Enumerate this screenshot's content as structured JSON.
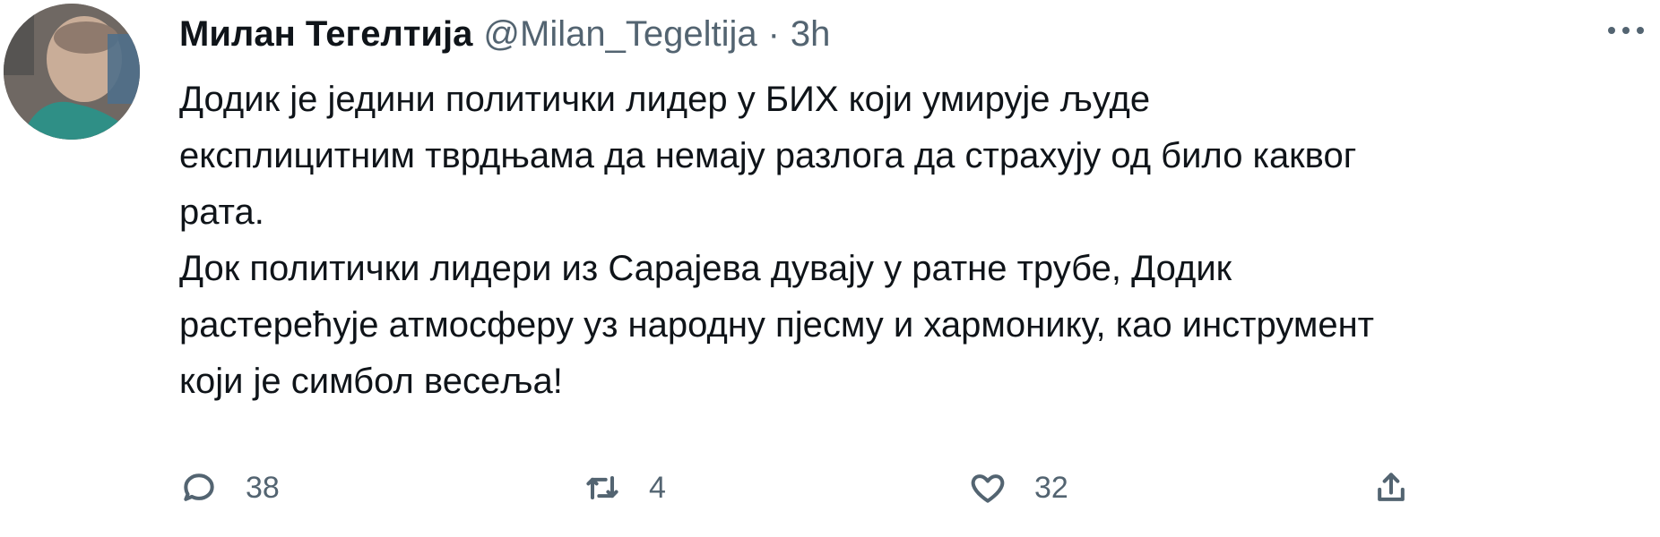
{
  "tweet": {
    "author": {
      "display_name": "Милан Тегелтија",
      "handle": "@Milan_Tegeltija"
    },
    "separator": "·",
    "timestamp": "3h",
    "paragraphs": [
      "Додик је једини политички лидер у БИХ који умирује људе\nексплицитним тврдњама да немају разлога да страхују од било каквог\nрата.",
      "Док политички лидери из Сарајева дувају у ратне трубе, Додик\nрастерећује атмосферу уз народну пјесму и хармонику, као инструмент\nкоји је симбол весеља!"
    ],
    "actions": {
      "reply": {
        "icon": "reply-icon",
        "count": "38"
      },
      "retweet": {
        "icon": "retweet-icon",
        "count": "4"
      },
      "like": {
        "icon": "heart-icon",
        "count": "32"
      },
      "share": {
        "icon": "share-icon"
      }
    }
  },
  "colors": {
    "text_primary": "#0f1419",
    "text_secondary": "#536471",
    "background": "#ffffff"
  }
}
